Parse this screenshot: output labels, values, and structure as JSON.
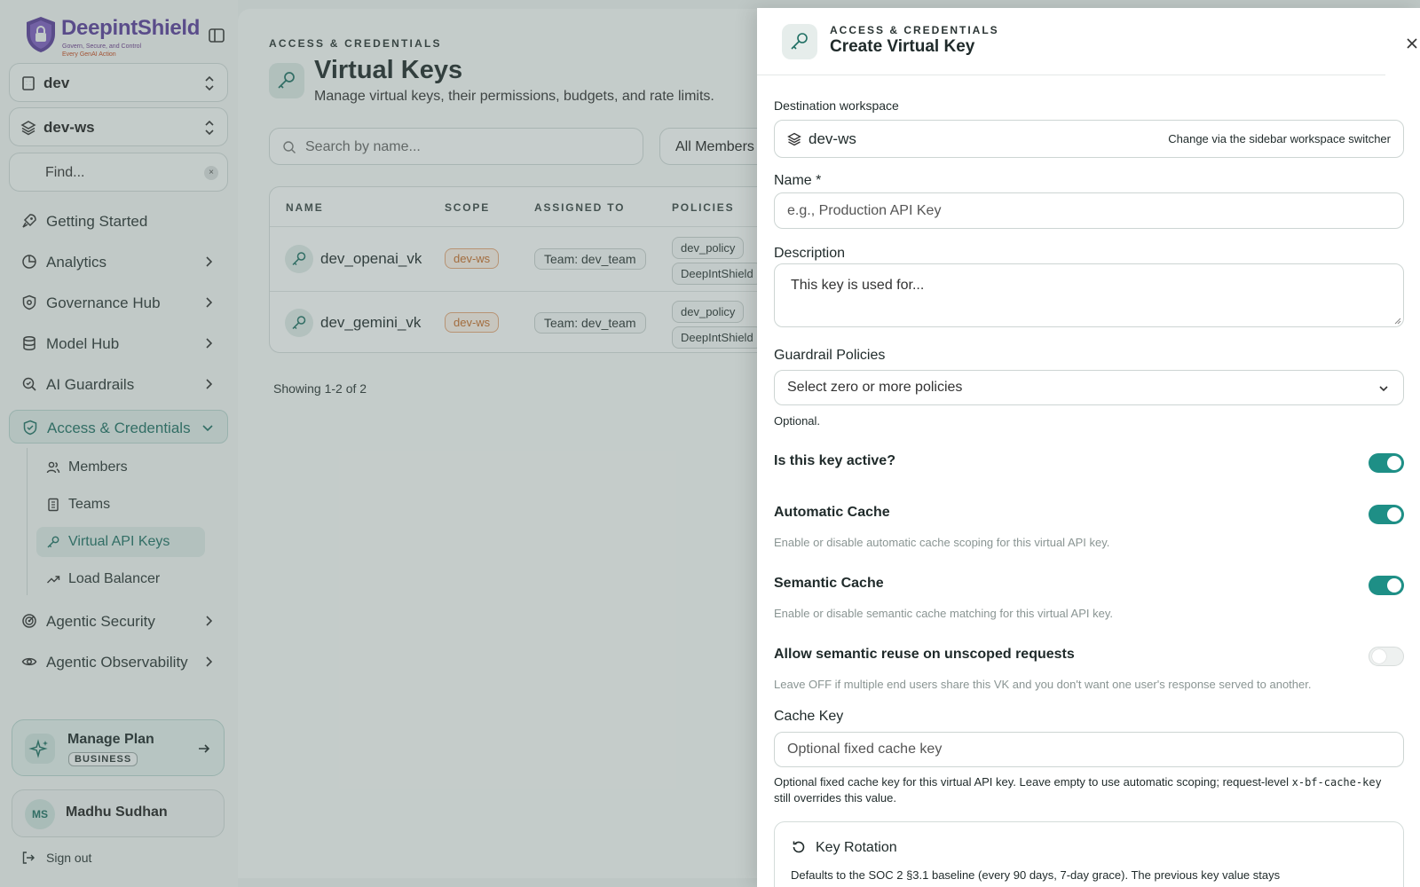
{
  "brand": {
    "name": "DeepintShield",
    "tagline_1": "Govern, Secure, and Control",
    "tagline_2": "Every GenAI Action"
  },
  "sidebar": {
    "org_switcher": {
      "label": "dev",
      "icon": "building-icon"
    },
    "workspace_switcher": {
      "label": "dev-ws",
      "icon": "layers-icon"
    },
    "find": {
      "label": "Find...",
      "clear": "×"
    },
    "nav": [
      {
        "label": "Getting Started",
        "icon": "rocket-icon"
      },
      {
        "label": "Analytics",
        "icon": "pie-chart-icon"
      },
      {
        "label": "Governance Hub",
        "icon": "shield-gear-icon"
      },
      {
        "label": "Model Hub",
        "icon": "database-icon"
      },
      {
        "label": "AI Guardrails",
        "icon": "search-scan-icon"
      },
      {
        "label": "Access & Credentials",
        "icon": "shield-check-icon"
      },
      {
        "label": "Agentic Security",
        "icon": "radar-icon"
      },
      {
        "label": "Agentic Observability",
        "icon": "eye-icon"
      }
    ],
    "sub_nav": [
      {
        "label": "Members",
        "icon": "users-icon"
      },
      {
        "label": "Teams",
        "icon": "building-icon"
      },
      {
        "label": "Virtual API Keys",
        "icon": "key-icon"
      },
      {
        "label": "Load Balancer",
        "icon": "trend-icon"
      }
    ],
    "plan": {
      "title": "Manage Plan",
      "badge": "BUSINESS"
    },
    "user": {
      "initials": "MS",
      "name": "Madhu Sudhan"
    },
    "sign_out": "Sign out"
  },
  "main": {
    "overline": "ACCESS & CREDENTIALS",
    "title": "Virtual Keys",
    "subtitle": "Manage virtual keys, their permissions, budgets, and rate limits.",
    "search_placeholder": "Search by name...",
    "member_filter": "All Members",
    "table": {
      "columns": [
        "NAME",
        "SCOPE",
        "ASSIGNED TO",
        "POLICIES"
      ],
      "rows": [
        {
          "name": "dev_openai_vk",
          "scope": "dev-ws",
          "assigned": "Team: dev_team",
          "policy_1": "dev_policy",
          "policy_2": "DeepIntShield"
        },
        {
          "name": "dev_gemini_vk",
          "scope": "dev-ws",
          "assigned": "Team: dev_team",
          "policy_1": "dev_policy",
          "policy_2": "DeepIntShield"
        }
      ]
    },
    "showing": "Showing 1-2 of 2"
  },
  "drawer": {
    "overline": "ACCESS & CREDENTIALS",
    "title": "Create Virtual Key",
    "destination_label": "Destination workspace",
    "workspace_name": "dev-ws",
    "workspace_hint": "Change via the sidebar workspace switcher",
    "name_label": "Name *",
    "name_placeholder": "e.g., Production API Key",
    "description_label": "Description",
    "description_placeholder": "This key is used for...",
    "policies_label": "Guardrail Policies",
    "policies_placeholder": "Select zero or more policies",
    "policies_helper": "Optional.",
    "toggles": [
      {
        "label": "Is this key active?",
        "on": true,
        "description": ""
      },
      {
        "label": "Automatic Cache",
        "on": true,
        "description": "Enable or disable automatic cache scoping for this virtual API key."
      },
      {
        "label": "Semantic Cache",
        "on": true,
        "description": "Enable or disable semantic cache matching for this virtual API key."
      },
      {
        "label": "Allow semantic reuse on unscoped requests",
        "on": false,
        "description": "Leave OFF if multiple end users share this VK and you don't want one user's response served to another."
      }
    ],
    "cache_key_label": "Cache Key",
    "cache_key_placeholder": "Optional fixed cache key",
    "cache_help_1": "Optional fixed cache key for this virtual API key. Leave empty to use automatic scoping; request-level ",
    "cache_help_code": "x-bf-cache-key",
    "cache_help_2": " still overrides this value.",
    "rotation_title": "Key Rotation",
    "rotation_desc": "Defaults to the SOC 2 §3.1 baseline (every 90 days, 7-day grace). The previous key value stays"
  },
  "colors": {
    "accent": "#1e8f86",
    "brand_purple": "#5a3d9a",
    "scope_orange": "#c56c2a"
  }
}
